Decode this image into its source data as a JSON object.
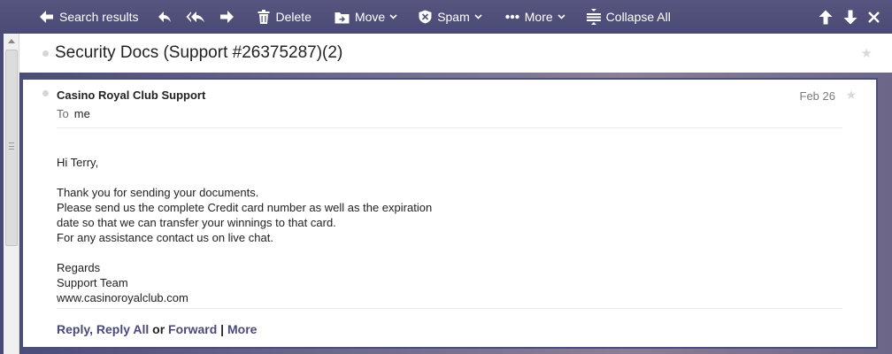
{
  "toolbar": {
    "back_label": "Search results",
    "delete_label": "Delete",
    "move_label": "Move",
    "spam_label": "Spam",
    "more_label": "More",
    "collapse_label": "Collapse All"
  },
  "subject": {
    "title": "Security Docs (Support #26375287)(2)"
  },
  "message": {
    "sender": "Casino Royal Club Support",
    "date": "Feb 26",
    "to_label": "To",
    "to_value": "me",
    "greeting": "Hi Terry,",
    "lines": [
      "Thank you for sending your documents.",
      "Please send us the complete Credit card number as well as the expiration",
      "date so that we can transfer your winnings to that card.",
      "For any assistance contact us on live chat."
    ],
    "signature": [
      "Regards",
      "Support Team",
      "www.casinoroyalclub.com"
    ]
  },
  "actions": {
    "reply": "Reply",
    "comma": ",",
    "reply_all": "Reply All",
    "or": "or",
    "forward": "Forward",
    "sep": "|",
    "more": "More"
  },
  "icons": {
    "toolbar_color": "#ffffff",
    "accent": "#4a4a7a"
  }
}
